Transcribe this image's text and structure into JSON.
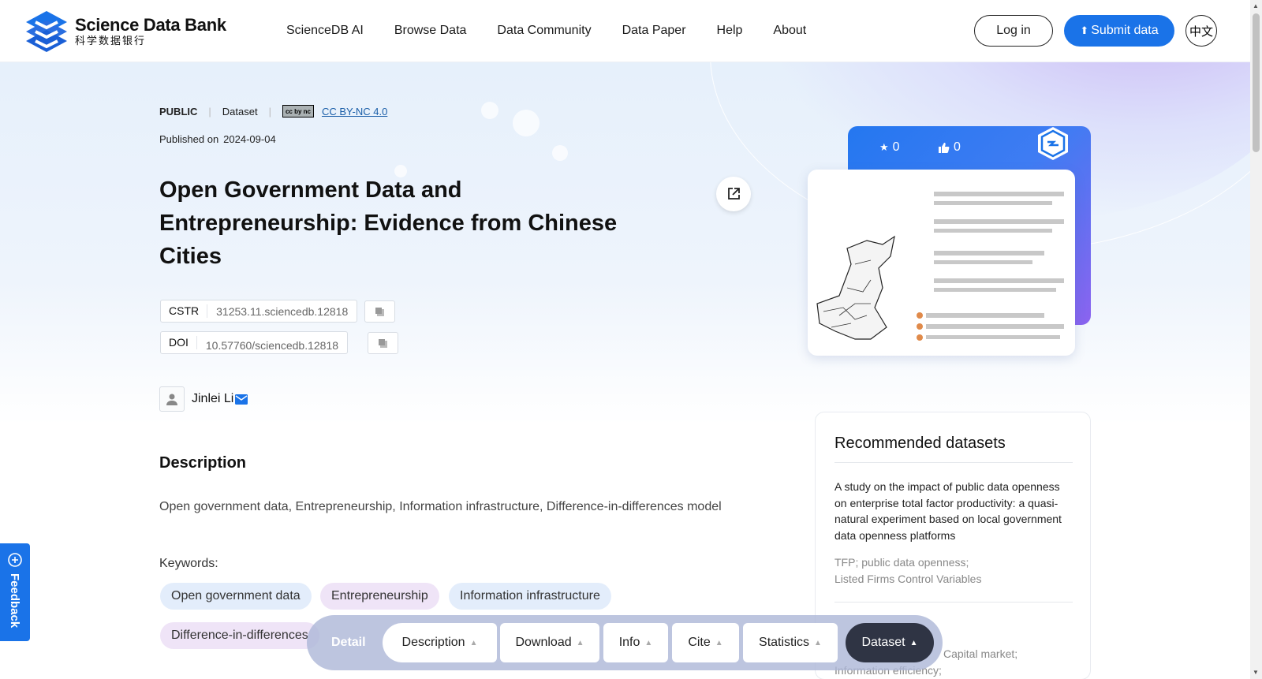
{
  "header": {
    "logo_en": "Science Data Bank",
    "logo_cn": "科学数据银行",
    "nav": [
      "ScienceDB AI",
      "Browse Data",
      "Data Community",
      "Data Paper",
      "Help",
      "About"
    ],
    "login_label": "Log in",
    "submit_label": "Submit data",
    "lang_label": "中文",
    "brand_color": "#1a73e8"
  },
  "dataset": {
    "visibility": "PUBLIC",
    "type": "Dataset",
    "license": "CC BY-NC 4.0",
    "published_label": "Published on",
    "published_date": "2024-09-04",
    "title": "Open Government Data and Entrepreneurship: Evidence from Chinese Cities",
    "cstr_label": "CSTR",
    "cstr_value": "31253.11.sciencedb.12818",
    "doi_label": "DOI",
    "doi_value": "10.57760/sciencedb.12818",
    "author": "Jinlei Li",
    "stars": "0",
    "likes": "0"
  },
  "description": {
    "heading": "Description",
    "text": "Open government data, Entrepreneurship, Information infrastructure, Difference-in-differences model",
    "keywords_label": "Keywords:",
    "keywords": [
      "Open government data",
      "Entrepreneurship",
      "Information infrastructure",
      "Difference-in-differences"
    ]
  },
  "recommended": {
    "heading": "Recommended datasets",
    "item1_title": "A study on the impact of public data openness on enterprise total factor productivity: a quasi-natural experiment based on local government data openness platforms",
    "item1_keywords_line1": "TFP; public data openness;",
    "item1_keywords_line2": "Listed Firms Control Variables",
    "item2_keywords_line1": "Capital market;",
    "item2_keywords_line2": "Information efficiency;"
  },
  "float_nav": {
    "detail_label": "Detail",
    "buttons": [
      "Description",
      "Download",
      "Info",
      "Cite",
      "Statistics",
      "Dataset"
    ]
  },
  "feedback_label": "Feedback"
}
